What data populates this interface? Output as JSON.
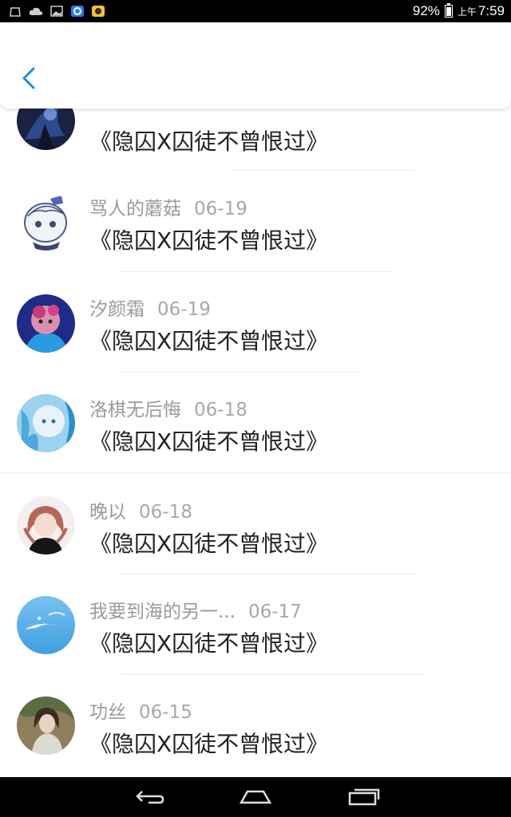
{
  "status_bar": {
    "battery_percent": "92%",
    "ampm": "上午",
    "time": "7:59",
    "battery_level": 0.92,
    "left_icons": [
      "android-icon",
      "cloud-icon",
      "image-icon",
      "browser-icon",
      "app-icon"
    ]
  },
  "header": {
    "back_icon": "chevron-left-icon",
    "accent": "#1a8fe3"
  },
  "items": [
    {
      "name": "",
      "date": "",
      "message": "《隐囚X囚徒不曾恨过》",
      "avatar": "dark-blue-character-avatar"
    },
    {
      "name": "骂人的蘑菇",
      "date": "06-19",
      "message": "《隐囚X囚徒不曾恨过》",
      "avatar": "white-hair-chibi-avatar"
    },
    {
      "name": "汐颜霜",
      "date": "06-19",
      "message": "《隐囚X囚徒不曾恨过》",
      "avatar": "purple-blue-anime-avatar"
    },
    {
      "name": "洛棋无后悔",
      "date": "06-18",
      "message": "《隐囚X囚徒不曾恨过》",
      "avatar": "light-blue-anime-avatar"
    },
    {
      "name": "晚以",
      "date": "06-18",
      "message": "《隐囚X囚徒不曾恨过》",
      "avatar": "brown-hair-girl-avatar"
    },
    {
      "name": "我要到海的另一...",
      "date": "06-17",
      "message": "《隐囚X囚徒不曾恨过》",
      "avatar": "sky-avatar"
    },
    {
      "name": "功丝",
      "date": "06-15",
      "message": "《隐囚X囚徒不曾恨过》",
      "avatar": "photo-girl-avatar"
    }
  ],
  "nav_bar": {
    "buttons": [
      "back-nav-icon",
      "home-nav-icon",
      "recents-nav-icon"
    ]
  }
}
